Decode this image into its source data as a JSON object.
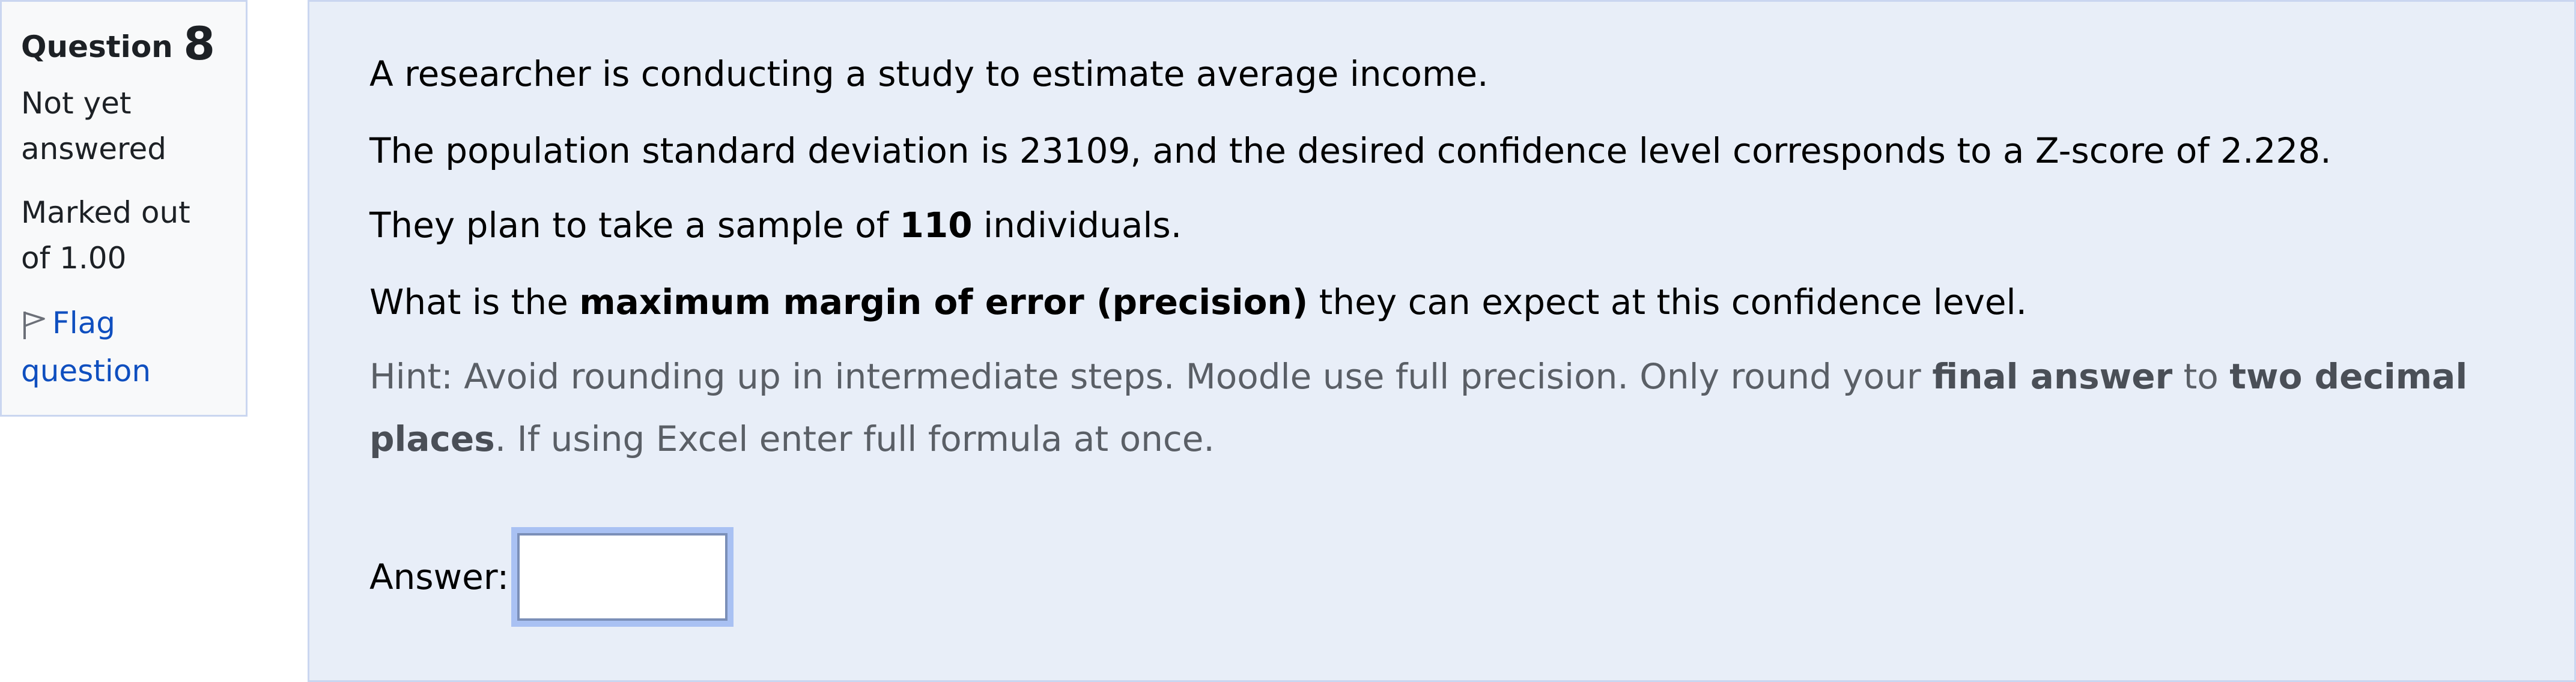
{
  "sidebar": {
    "question_label": "Question",
    "question_number": "8",
    "state": "Not yet answered",
    "grade": "Marked out of 1.00",
    "flag_label": "Flag question",
    "flag_icon": "flag-icon"
  },
  "question": {
    "line1": "A researcher is conducting a study to estimate average income.",
    "line2": "The population standard deviation is 23109, and the desired confidence level corresponds to a Z-score of 2.228.",
    "line3_pre": "They plan to take a sample of ",
    "line3_bold": "110",
    "line3_post": " individuals.",
    "line4_pre": "What is the ",
    "line4_bold": "maximum margin of error (precision)",
    "line4_post": " they can expect at this confidence level.",
    "hint_pre": "Hint: Avoid rounding up in intermediate steps. Moodle use full precision. Only round your ",
    "hint_bold1": "final answer",
    "hint_mid": " to ",
    "hint_bold2": "two decimal places",
    "hint_post": ". If using Excel enter full formula at once."
  },
  "answer": {
    "label": "Answer:",
    "value": ""
  },
  "colors": {
    "content_bg": "#e8eef8",
    "border": "#cad6f0",
    "link": "#0f4fbf",
    "hint_text": "#5a5f66"
  }
}
